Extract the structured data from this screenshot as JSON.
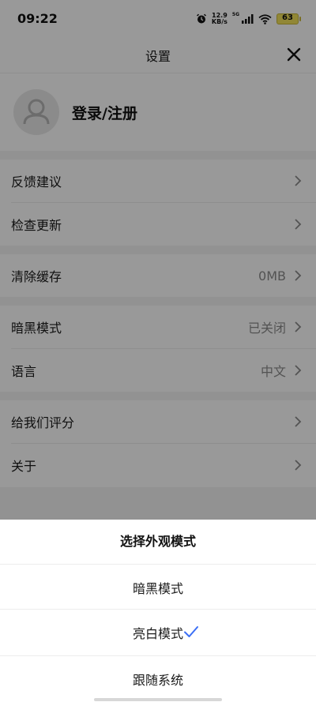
{
  "status_bar": {
    "time": "09:22",
    "net_speed_value": "12.9",
    "net_speed_unit": "KB/s",
    "signal_type": "5G",
    "battery_level": "63",
    "icons": [
      "alarm-icon",
      "signal-icon",
      "wifi-icon",
      "battery-icon"
    ]
  },
  "header": {
    "title": "设置"
  },
  "profile": {
    "login_label": "登录/注册"
  },
  "settings": {
    "feedback": {
      "label": "反馈建议"
    },
    "check_update": {
      "label": "检查更新"
    },
    "clear_cache": {
      "label": "清除缓存",
      "value": "0MB"
    },
    "dark_mode": {
      "label": "暗黑模式",
      "value": "已关闭"
    },
    "language": {
      "label": "语言",
      "value": "中文"
    },
    "rate_us": {
      "label": "给我们评分"
    },
    "about": {
      "label": "关于"
    }
  },
  "appearance_sheet": {
    "title": "选择外观模式",
    "options": [
      {
        "label": "暗黑模式",
        "selected": false
      },
      {
        "label": "亮白模式",
        "selected": true
      },
      {
        "label": "跟随系统",
        "selected": false
      }
    ]
  },
  "colors": {
    "overlay": "#000000",
    "check_accent": "#3b6ff5",
    "battery_fill": "#f2e15a"
  }
}
